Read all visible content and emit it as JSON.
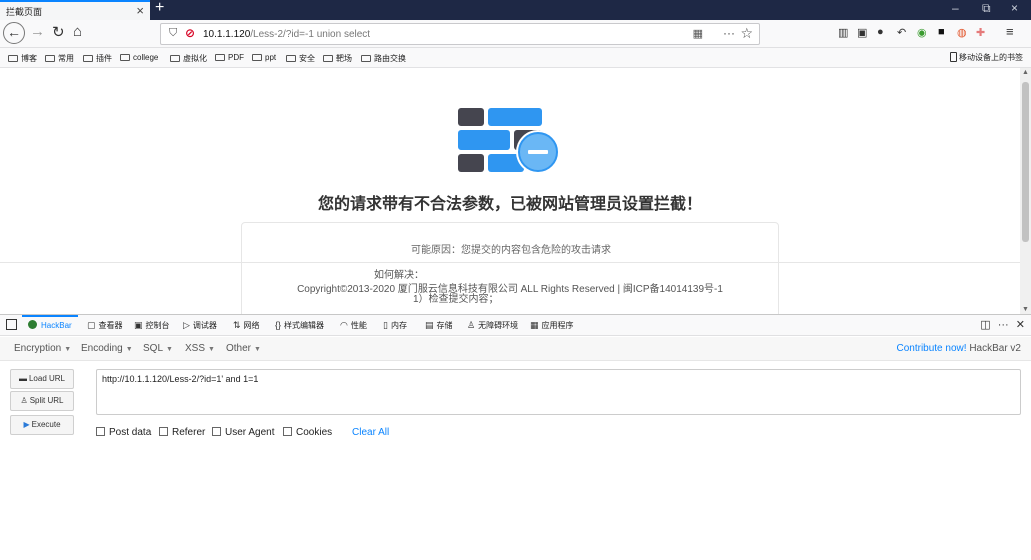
{
  "browser": {
    "tab_title": "拦截页面",
    "tab_close": "×",
    "new_tab": "+",
    "window_controls": [
      "–",
      "⧉",
      "×"
    ]
  },
  "navbar": {
    "back_icon": "←",
    "forward_icon": "→",
    "reload_icon": "↻",
    "home_icon": "⌂",
    "url_host": "10.1.1.120",
    "url_path": "/Less-2/?id=-1 union select",
    "qr_icon": "▦",
    "more_icon": "···",
    "star_icon": "☆",
    "toolbar_icons": [
      "library-icon",
      "sidebar-icon",
      "account-icon",
      "back-arrow-icon",
      "globe-icon",
      "extension-icon",
      "extension-icon",
      "extension-icon",
      "menu-icon"
    ]
  },
  "bookmarks": {
    "items": [
      "博客",
      "常用",
      "插件",
      "college",
      "虚拟化",
      "PDF",
      "ppt",
      "安全",
      "靶场",
      "路由交换"
    ],
    "mobile": "移动设备上的书签"
  },
  "page": {
    "title": "您的请求带有不合法参数，已被网站管理员设置拦截！",
    "reason": "可能原因：您提交的内容包含危险的攻击请求",
    "solution_title": "如何解决：",
    "copyright": "Copyright©2013-2020 厦门服云信息科技有限公司 ALL Rights Reserved | 闽ICP备14014139号-1",
    "solution_item": "1）检查提交内容；"
  },
  "devtools": {
    "tabs": [
      {
        "label": "HackBar",
        "icon": "hackbar-icon"
      },
      {
        "label": "查看器",
        "icon": "inspector-icon"
      },
      {
        "label": "控制台",
        "icon": "console-icon"
      },
      {
        "label": "调试器",
        "icon": "debugger-icon"
      },
      {
        "label": "网络",
        "icon": "network-icon"
      },
      {
        "label": "样式编辑器",
        "icon": "style-editor-icon"
      },
      {
        "label": "性能",
        "icon": "performance-icon"
      },
      {
        "label": "内存",
        "icon": "memory-icon"
      },
      {
        "label": "存储",
        "icon": "storage-icon"
      },
      {
        "label": "无障碍环境",
        "icon": "accessibility-icon"
      },
      {
        "label": "应用程序",
        "icon": "application-icon"
      }
    ],
    "right_controls": [
      "dock-icon",
      "more-icon",
      "close-icon"
    ]
  },
  "hackbar": {
    "menu": [
      "Encryption",
      "Encoding",
      "SQL",
      "XSS",
      "Other"
    ],
    "contribute_link": "Contribute now!",
    "version": "HackBar v2",
    "buttons": {
      "load_url": "Load URL",
      "split_url": "Split URL",
      "execute": "Execute"
    },
    "url_value": "http://10.1.1.120/Less-2/?id=1' and 1=1",
    "options": {
      "post_data": "Post data",
      "referer": "Referer",
      "user_agent": "User Agent",
      "cookies": "Cookies"
    },
    "clear_all": "Clear All"
  },
  "colors": {
    "accent": "#0a84ff",
    "titlebar": "#1e2845",
    "icon_dark": "#45454f",
    "icon_blue": "#2f96f1"
  }
}
